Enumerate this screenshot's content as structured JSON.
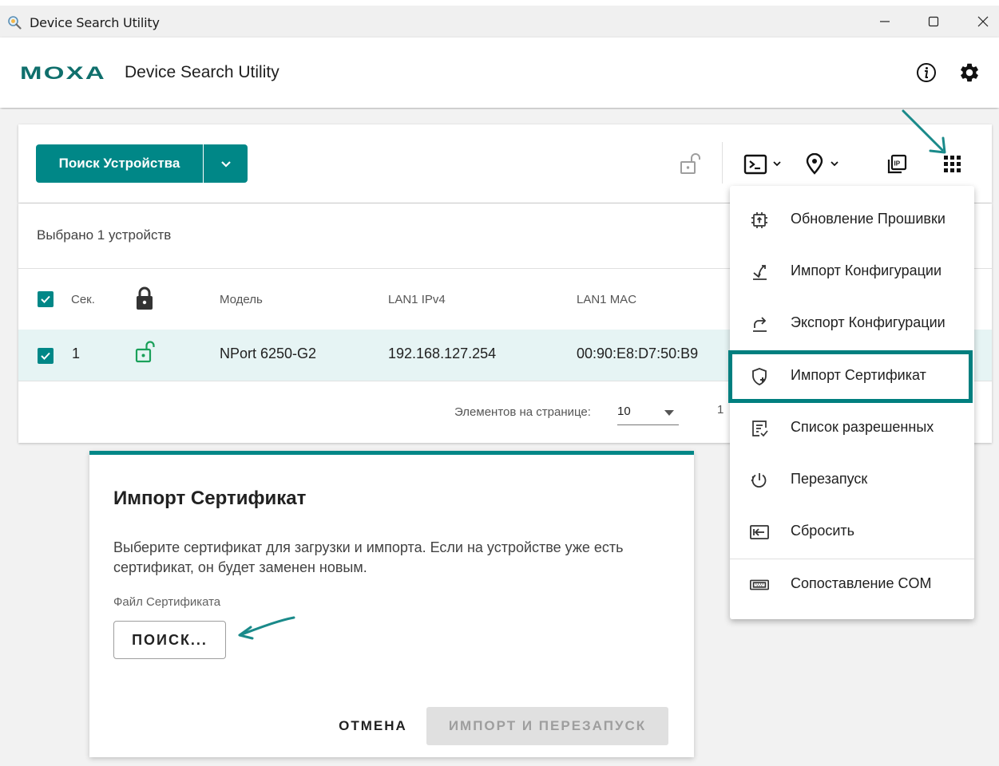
{
  "window": {
    "title": "Device Search Utility",
    "controls": [
      "minimize",
      "maximize",
      "close"
    ]
  },
  "header": {
    "logo_text": "MOXA",
    "app_title": "Device Search Utility",
    "icons": [
      "info-icon",
      "settings-icon"
    ]
  },
  "toolbar": {
    "search_button_label": "Поиск Устройства",
    "icons": [
      "unlock-icon",
      "terminal-icon",
      "location-icon",
      "ip-icon",
      "apps-grid-icon"
    ]
  },
  "table": {
    "selected_text": "Выбрано 1 устройств",
    "columns": [
      "Сек.",
      "Модель",
      "LAN1 IPv4",
      "LAN1 MAC"
    ],
    "rows": [
      {
        "sec": "1",
        "model": "NPort 6250-G2",
        "ipv4": "192.168.127.254",
        "mac": "00:90:E8:D7:50:B9"
      }
    ],
    "pager": {
      "label": "Элементов на странице:",
      "value": "10",
      "range": "1"
    }
  },
  "menu": {
    "items": [
      {
        "label": "Обновление Прошивки",
        "icon": "firmware-icon"
      },
      {
        "label": "Импорт Конфигурации",
        "icon": "import-config-icon"
      },
      {
        "label": "Экспорт Конфигурации",
        "icon": "export-config-icon"
      },
      {
        "label": "Импорт Сертификат",
        "icon": "certificate-icon",
        "highlighted": true
      },
      {
        "label": "Список разрешенных",
        "icon": "allowlist-icon"
      },
      {
        "label": "Перезапуск",
        "icon": "restart-icon"
      },
      {
        "label": "Сбросить",
        "icon": "reset-icon"
      },
      {
        "label": "Сопоставление COM",
        "icon": "com-mapping-icon"
      }
    ]
  },
  "dialog": {
    "title": "Импорт Сертификат",
    "description": "Выберите сертификат для загрузки и импорта. Если на устройстве уже есть сертификат, он будет заменен новым.",
    "field_label": "Файл Сертификата",
    "browse_button": "ПОИСК...",
    "cancel_button": "ОТМЕНА",
    "import_button": "ИМПОРТ И ПЕРЕЗАПУСК"
  },
  "colors": {
    "accent": "#008787",
    "annotation": "#1a8a8a",
    "selected_row": "#e6f4f4"
  }
}
